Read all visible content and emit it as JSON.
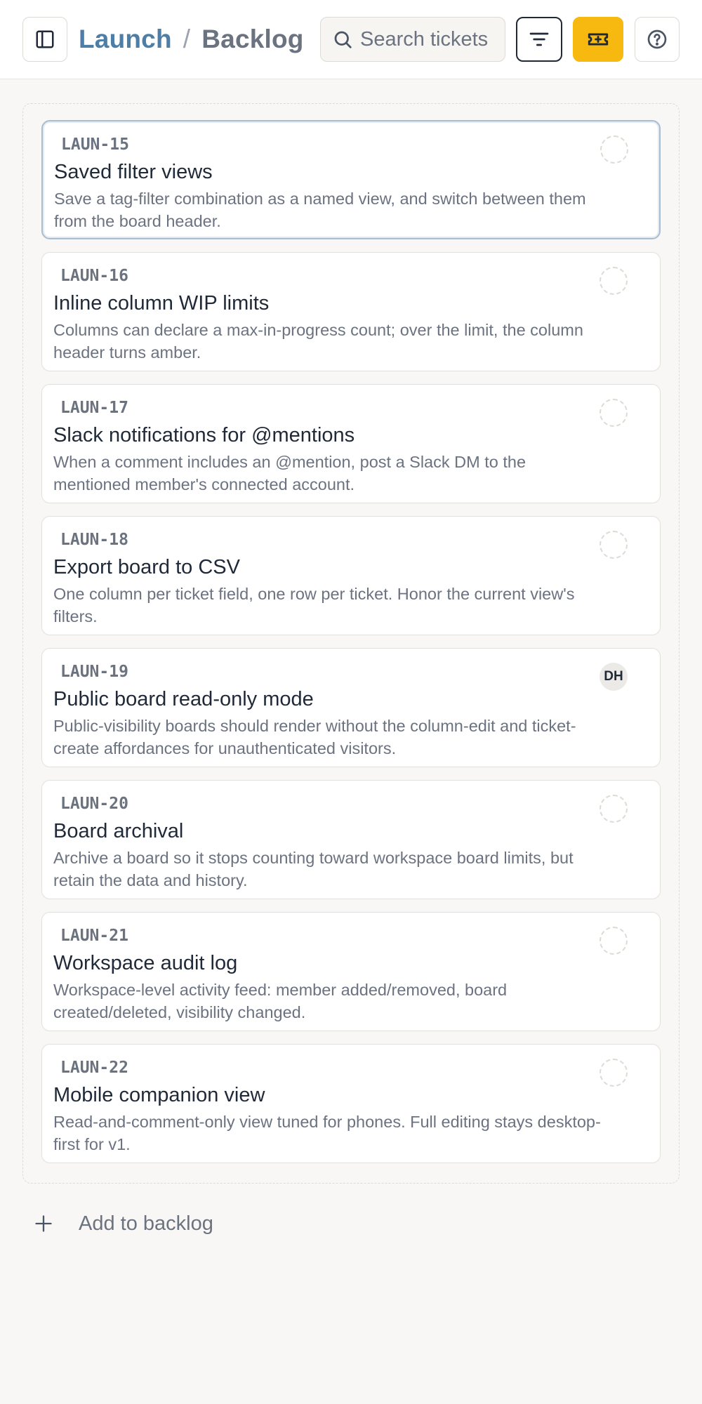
{
  "header": {
    "project": "Launch",
    "separator": "/",
    "current": "Backlog",
    "search_placeholder": "Search tickets",
    "accent_color": "#f7b90f"
  },
  "icons": {
    "sidebar_toggle": "sidebar-icon",
    "search": "search-icon",
    "filter": "filter-icon",
    "new_ticket": "ticket-plus-icon",
    "help": "help-icon",
    "add": "plus-icon"
  },
  "tickets": [
    {
      "id": "LAUN-15",
      "title": "Saved filter views",
      "description": "Save a tag-filter combination as a named view, and switch between them from the board header.",
      "assignee": "",
      "selected": true
    },
    {
      "id": "LAUN-16",
      "title": "Inline column WIP limits",
      "description": "Columns can declare a max-in-progress count; over the limit, the column header turns amber.",
      "assignee": ""
    },
    {
      "id": "LAUN-17",
      "title": "Slack notifications for @mentions",
      "description": "When a comment includes an @mention, post a Slack DM to the mentioned member's connected account.",
      "assignee": ""
    },
    {
      "id": "LAUN-18",
      "title": "Export board to CSV",
      "description": "One column per ticket field, one row per ticket. Honor the current view's filters.",
      "assignee": ""
    },
    {
      "id": "LAUN-19",
      "title": "Public board read-only mode",
      "description": "Public-visibility boards should render without the column-edit and ticket-create affordances for unauthenticated visitors.",
      "assignee": "DH"
    },
    {
      "id": "LAUN-20",
      "title": "Board archival",
      "description": "Archive a board so it stops counting toward workspace board limits, but retain the data and history.",
      "assignee": ""
    },
    {
      "id": "LAUN-21",
      "title": "Workspace audit log",
      "description": "Workspace-level activity feed: member added/removed, board created/deleted, visibility changed.",
      "assignee": ""
    },
    {
      "id": "LAUN-22",
      "title": "Mobile companion view",
      "description": "Read-and-comment-only view tuned for phones. Full editing stays desktop-first for v1.",
      "assignee": ""
    }
  ],
  "add_label": "Add to backlog"
}
